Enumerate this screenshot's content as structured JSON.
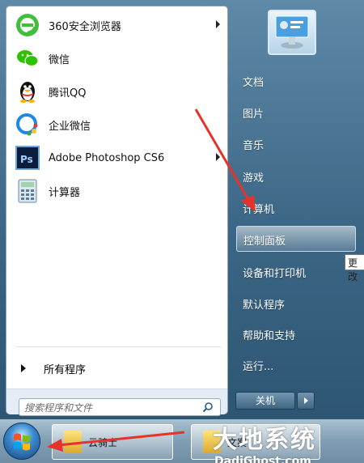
{
  "start_menu": {
    "programs": [
      {
        "label": "360安全浏览器",
        "icon": "browser-360-icon",
        "has_submenu": true
      },
      {
        "label": "微信",
        "icon": "wechat-icon",
        "has_submenu": false
      },
      {
        "label": "腾讯QQ",
        "icon": "qq-penguin-icon",
        "has_submenu": false
      },
      {
        "label": "企业微信",
        "icon": "wecom-icon",
        "has_submenu": false
      },
      {
        "label": "Adobe Photoshop CS6",
        "icon": "photoshop-icon",
        "has_submenu": true
      },
      {
        "label": "计算器",
        "icon": "calculator-icon",
        "has_submenu": false
      }
    ],
    "all_programs": "所有程序",
    "search_placeholder": "搜索程序和文件",
    "right_items": [
      "文档",
      "图片",
      "音乐",
      "游戏",
      "计算机",
      "控制面板",
      "设备和打印机",
      "默认程序",
      "帮助和支持",
      "运行..."
    ],
    "highlighted_item": "控制面板",
    "tooltip": "更改",
    "shutdown_label": "关机"
  },
  "taskbar": {
    "items": [
      {
        "label": "云骑士",
        "icon": "folder-icon"
      },
      {
        "label": "文案",
        "icon": "folder-icon"
      }
    ]
  },
  "watermark": {
    "brand": "大地系统",
    "url": "DadiGhost.com"
  },
  "colors": {
    "annotation_arrow": "#e5332a",
    "menu_accent": "#3b6685"
  }
}
